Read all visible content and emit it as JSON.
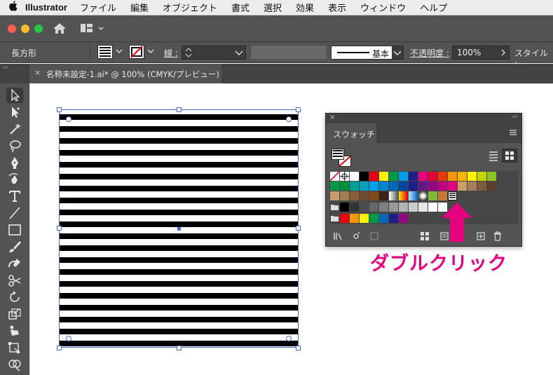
{
  "menubar": {
    "apple_symbol": "",
    "app_name": "Illustrator",
    "items": [
      "ファイル",
      "編集",
      "オブジェクト",
      "書式",
      "選択",
      "効果",
      "表示",
      "ウィンドウ",
      "ヘルプ"
    ]
  },
  "controlbar": {
    "tool_name": "長方形",
    "stroke_label": "線 :",
    "brush_label": "基本",
    "opacity_label": "不透明度 :",
    "opacity_value": "100%",
    "style_label": "スタイル :"
  },
  "document_tab": {
    "close": "×",
    "title": "名称未設定-1.ai* @ 100% (CMYK/プレビュー)"
  },
  "panel": {
    "close": "×",
    "collapse": "‹‹",
    "tab_label": "スウォッチ",
    "swatch_colors": {
      "row1": [
        "#ffffff",
        "#000000",
        "#e60012",
        "#fff100",
        "#009944",
        "#00a0e9",
        "#1d2088",
        "#e4007f",
        "#e60033",
        "#e8380d",
        "#f39800",
        "#f8b500",
        "#fff100",
        "#c8d400",
        "#8fc31f"
      ],
      "row2": [
        "#009944",
        "#009e96",
        "#00a0e9",
        "#0086d1",
        "#0068b7",
        "#00479d",
        "#1d2088",
        "#601986",
        "#920783",
        "#be0081",
        "#e4007f",
        "#c9a063",
        "#a47e5b",
        "#7d5b3f",
        "#5a3e28"
      ],
      "row3": [
        "#c69c6d",
        "#a67c52",
        "#8b5e3c",
        "#6d4c2f",
        "#7f4a1c",
        "#3c2314",
        "#f0f0f0",
        "#ff9900",
        "#6ec6f0",
        "#3f7fd3",
        "#ffffff",
        "#7ab83a",
        "#c47a3a",
        "#7b6650"
      ],
      "row4": [
        "#000000",
        "#333333",
        "#4d4d4d",
        "#666666",
        "#808080",
        "#999999",
        "#b3b3b3",
        "#cccccc",
        "#e6e6e6",
        "#ffffff"
      ],
      "row5": [
        "#e60012",
        "#f39800",
        "#fff100",
        "#009944",
        "#0068b7",
        "#1d2088",
        "#920783"
      ]
    }
  },
  "annotation": {
    "text": "ダブルクリック",
    "color": "#e4007f"
  }
}
